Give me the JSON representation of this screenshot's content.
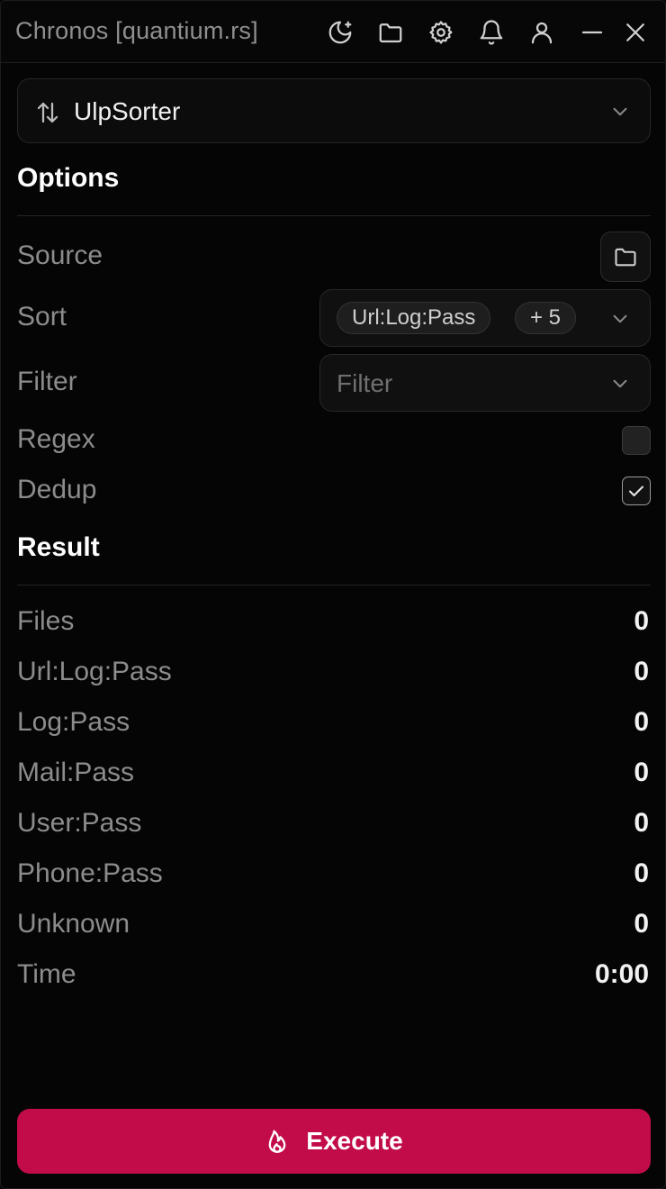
{
  "app": {
    "title": "Chronos [quantium.rs]"
  },
  "titlebar_icons": [
    "moon-plus-icon",
    "folder-icon",
    "gear-icon",
    "bell-icon",
    "user-icon",
    "minimize-icon",
    "close-icon"
  ],
  "tool_select": {
    "value": "UlpSorter",
    "icon": "sort-arrows-icon"
  },
  "options": {
    "heading": "Options",
    "source": {
      "label": "Source"
    },
    "sort": {
      "label": "Sort",
      "selected_chip": "Url:Log:Pass",
      "more_chip": "+ 5"
    },
    "filter": {
      "label": "Filter",
      "placeholder": "Filter"
    },
    "regex": {
      "label": "Regex",
      "checked": false
    },
    "dedup": {
      "label": "Dedup",
      "checked": true
    }
  },
  "result": {
    "heading": "Result",
    "rows": [
      {
        "label": "Files",
        "value": "0"
      },
      {
        "label": "Url:Log:Pass",
        "value": "0"
      },
      {
        "label": "Log:Pass",
        "value": "0"
      },
      {
        "label": "Mail:Pass",
        "value": "0"
      },
      {
        "label": "User:Pass",
        "value": "0"
      },
      {
        "label": "Phone:Pass",
        "value": "0"
      },
      {
        "label": "Unknown",
        "value": "0"
      },
      {
        "label": "Time",
        "value": "0:00"
      }
    ]
  },
  "execute": {
    "label": "Execute",
    "icon": "flame-icon"
  },
  "colors": {
    "accent": "#c20c4a",
    "background": "#050505",
    "muted_text": "#8c8c8c"
  }
}
